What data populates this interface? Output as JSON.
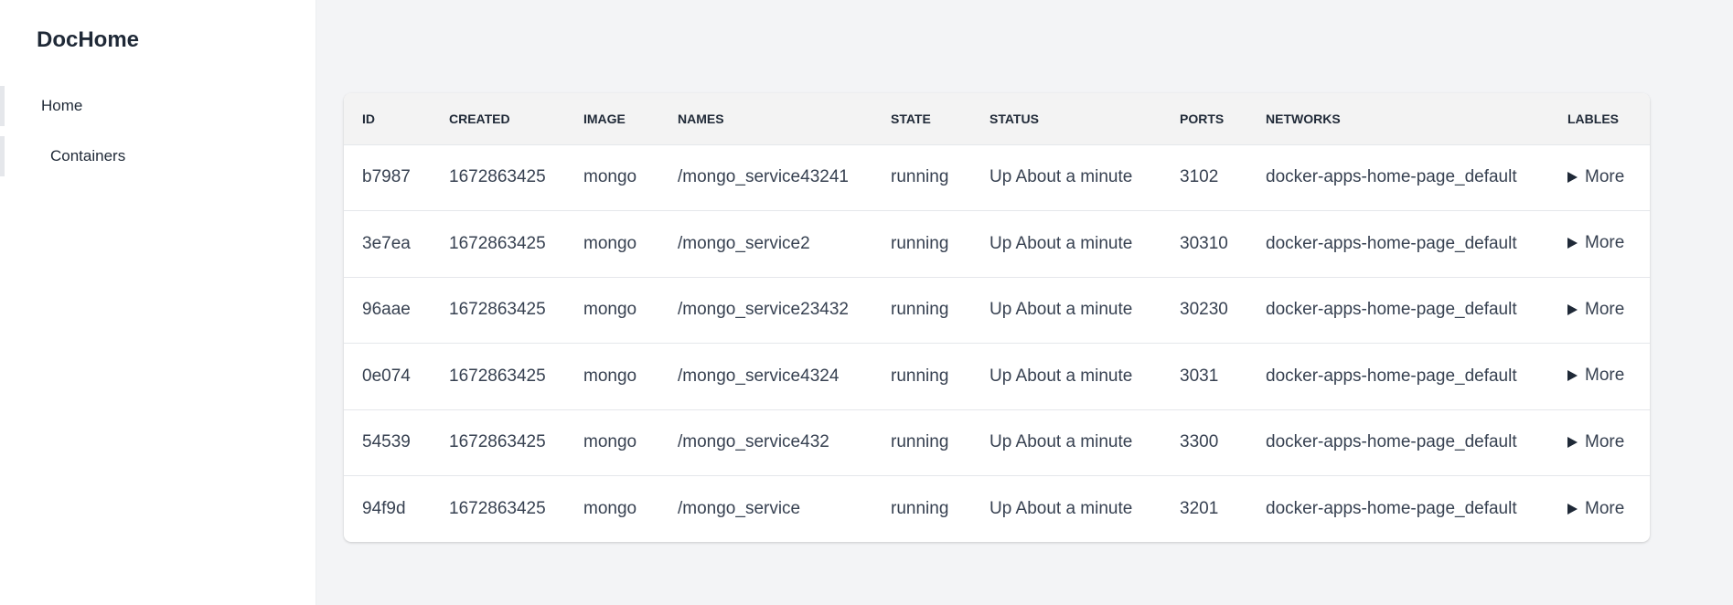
{
  "app": {
    "brand": "DocHome"
  },
  "sidebar": {
    "items": [
      {
        "label": "Home"
      },
      {
        "label": "Containers"
      }
    ]
  },
  "table": {
    "columns": [
      "ID",
      "CREATED",
      "IMAGE",
      "NAMES",
      "STATE",
      "STATUS",
      "PORTS",
      "NETWORKS",
      "LABLES"
    ],
    "rows": [
      {
        "id": "b7987",
        "created": "1672863425",
        "image": "mongo",
        "names": "/mongo_service43241",
        "state": "running",
        "status": "Up About a minute",
        "ports": "3102",
        "networks": "docker-apps-home-page_default",
        "labels": "More"
      },
      {
        "id": "3e7ea",
        "created": "1672863425",
        "image": "mongo",
        "names": "/mongo_service2",
        "state": "running",
        "status": "Up About a minute",
        "ports": "30310",
        "networks": "docker-apps-home-page_default",
        "labels": "More"
      },
      {
        "id": "96aae",
        "created": "1672863425",
        "image": "mongo",
        "names": "/mongo_service23432",
        "state": "running",
        "status": "Up About a minute",
        "ports": "30230",
        "networks": "docker-apps-home-page_default",
        "labels": "More"
      },
      {
        "id": "0e074",
        "created": "1672863425",
        "image": "mongo",
        "names": "/mongo_service4324",
        "state": "running",
        "status": "Up About a minute",
        "ports": "3031",
        "networks": "docker-apps-home-page_default",
        "labels": "More"
      },
      {
        "id": "54539",
        "created": "1672863425",
        "image": "mongo",
        "names": "/mongo_service432",
        "state": "running",
        "status": "Up About a minute",
        "ports": "3300",
        "networks": "docker-apps-home-page_default",
        "labels": "More"
      },
      {
        "id": "94f9d",
        "created": "1672863425",
        "image": "mongo",
        "names": "/mongo_service",
        "state": "running",
        "status": "Up About a minute",
        "ports": "3201",
        "networks": "docker-apps-home-page_default",
        "labels": "More"
      }
    ]
  },
  "icons": {
    "expand": "triangle-right-icon"
  }
}
